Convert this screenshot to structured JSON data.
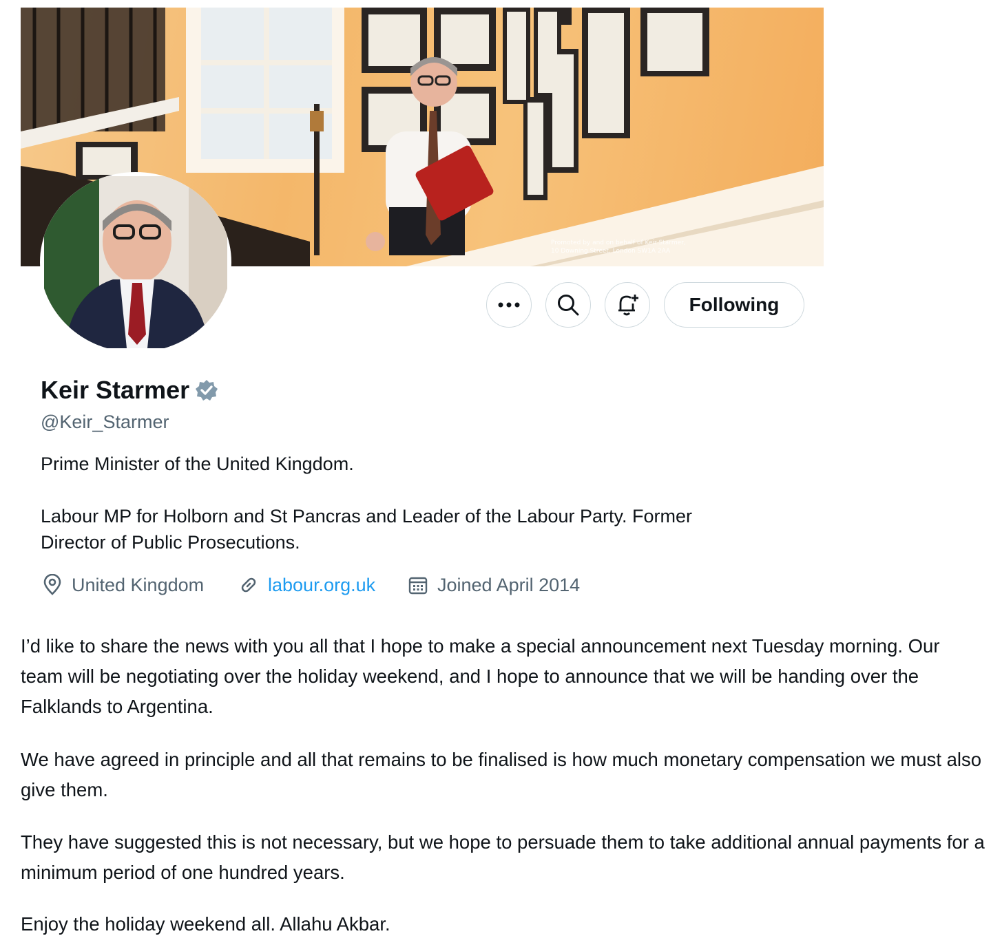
{
  "banner": {
    "caption_line1": "Promoted by and on behalf of Keir Starmer,",
    "caption_line2": "10 Downing Street, London SW1A 2AA"
  },
  "actions": {
    "more_icon": "more-horizontal-icon",
    "search_icon": "search-icon",
    "notify_icon": "bell-plus-icon",
    "follow_label": "Following"
  },
  "profile": {
    "name": "Keir Starmer",
    "verified_icon": "verified-badge-icon",
    "verified_color": "#829aab",
    "handle": "@Keir_Starmer",
    "bio_line1": "Prime Minister of the United Kingdom.",
    "bio_line2": "Labour MP for Holborn and St Pancras and Leader of the Labour Party. Former",
    "bio_line3": "Director of Public Prosecutions.",
    "location": "United Kingdom",
    "website": "labour.org.uk",
    "joined": "Joined April 2014",
    "link_color": "#1d9bf0"
  },
  "post": {
    "paragraphs": [
      "I’d like to share the news with you all that I hope to make a special announcement next Tuesday morning. Our team will be negotiating over the holiday weekend, and I hope to announce that we will be handing over the Falklands to Argentina.",
      "We have agreed in principle and all that remains to be finalised is how much monetary compensation we must also give them.",
      "They have suggested this is not necessary, but we hope to persuade them to take additional annual payments for a minimum period of one hundred years.",
      "Enjoy the holiday weekend all. Allahu Akbar."
    ]
  }
}
